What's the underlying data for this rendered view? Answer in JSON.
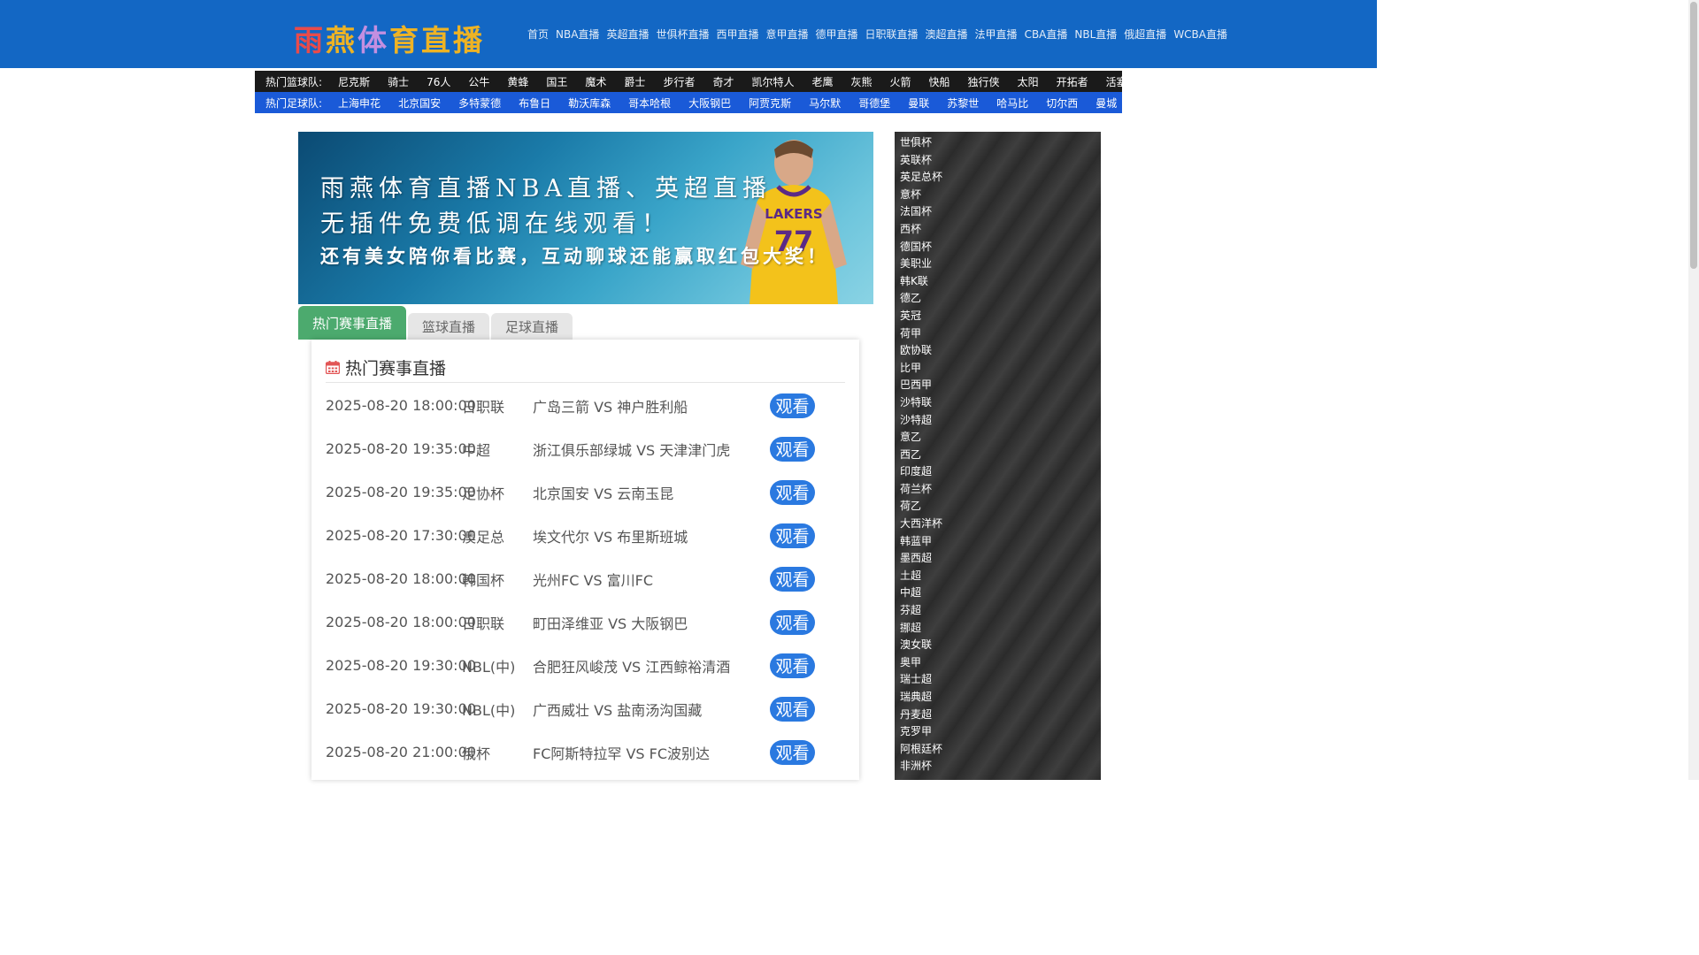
{
  "header": {
    "logo": [
      "雨",
      "燕",
      "体",
      "育",
      "直",
      "播"
    ],
    "nav": [
      "首页",
      "NBA直播",
      "英超直播",
      "世俱杯直播",
      "西甲直播",
      "意甲直播",
      "德甲直播",
      "日职联直播",
      "澳超直播",
      "法甲直播",
      "CBA直播",
      "NBL直播",
      "俄超直播",
      "WCBA直播"
    ]
  },
  "basketball_teams": {
    "label": "热门篮球队:",
    "items": [
      "尼克斯",
      "骑士",
      "76人",
      "公牛",
      "黄蜂",
      "国王",
      "魔术",
      "爵士",
      "步行者",
      "奇才",
      "凯尔特人",
      "老鹰",
      "灰熊",
      "火箭",
      "快船",
      "独行侠",
      "太阳",
      "开拓者",
      "活塞"
    ]
  },
  "football_teams": {
    "label": "热门足球队:",
    "items": [
      "上海申花",
      "北京国安",
      "多特蒙德",
      "布鲁日",
      "勒沃库森",
      "哥本哈根",
      "大阪钢巴",
      "阿贾克斯",
      "马尔默",
      "哥德堡",
      "曼联",
      "苏黎世",
      "哈马比",
      "切尔西",
      "曼城"
    ]
  },
  "banner": {
    "line1": "雨燕体育直播NBA直播、英超直播",
    "line2": "无插件免费低调在线观看！",
    "line3": "还有美女陪你看比赛，互动聊球还能赢取红包大奖！",
    "jersey_text": "LAKERS",
    "jersey_number": "77"
  },
  "tabs": [
    "热门赛事直播",
    "篮球直播",
    "足球直播"
  ],
  "panel": {
    "title": "热门赛事直播",
    "watch_label": "观看",
    "rows": [
      {
        "time": "2025-08-20 18:00:00",
        "league": "日职联",
        "match": "广岛三箭 VS 神户胜利船"
      },
      {
        "time": "2025-08-20 19:35:00",
        "league": "中超",
        "match": "浙江俱乐部绿城 VS 天津津门虎"
      },
      {
        "time": "2025-08-20 19:35:00",
        "league": "足协杯",
        "match": "北京国安 VS 云南玉昆"
      },
      {
        "time": "2025-08-20 17:30:00",
        "league": "澳足总",
        "match": "埃文代尔 VS 布里斯班城"
      },
      {
        "time": "2025-08-20 18:00:00",
        "league": "韩国杯",
        "match": "光州FC VS 富川FC"
      },
      {
        "time": "2025-08-20 18:00:00",
        "league": "日职联",
        "match": "町田泽维亚 VS 大阪钢巴"
      },
      {
        "time": "2025-08-20 19:30:00",
        "league": "NBL(中)",
        "match": "合肥狂风峻茂 VS 江西鲸裕清酒"
      },
      {
        "time": "2025-08-20 19:30:00",
        "league": "NBL(中)",
        "match": "广西威壮 VS 盐南汤沟国藏"
      },
      {
        "time": "2025-08-20 21:00:00",
        "league": "俄杯",
        "match": "FC阿斯特拉罕 VS FC波别达"
      }
    ]
  },
  "sidebar": {
    "items": [
      "世俱杯",
      "英联杯",
      "英足总杯",
      "意杯",
      "法国杯",
      "西杯",
      "德国杯",
      "美职业",
      "韩K联",
      "德乙",
      "英冠",
      "荷甲",
      "欧协联",
      "比甲",
      "巴西甲",
      "沙特联",
      "沙特超",
      "意乙",
      "西乙",
      "印度超",
      "荷兰杯",
      "荷乙",
      "大西洋杯",
      "韩蓝甲",
      "墨西超",
      "土超",
      "中超",
      "芬超",
      "挪超",
      "澳女联",
      "奥甲",
      "瑞士超",
      "瑞典超",
      "丹麦超",
      "克罗甲",
      "阿根廷杯",
      "非洲杯"
    ]
  },
  "colors": {
    "header_bg": "#1367c4",
    "basketball_bar": "#1a1a1a",
    "football_bar": "#1a5ad8",
    "active_tab": "#4caa6e",
    "watch_button": "#2a79e0"
  }
}
